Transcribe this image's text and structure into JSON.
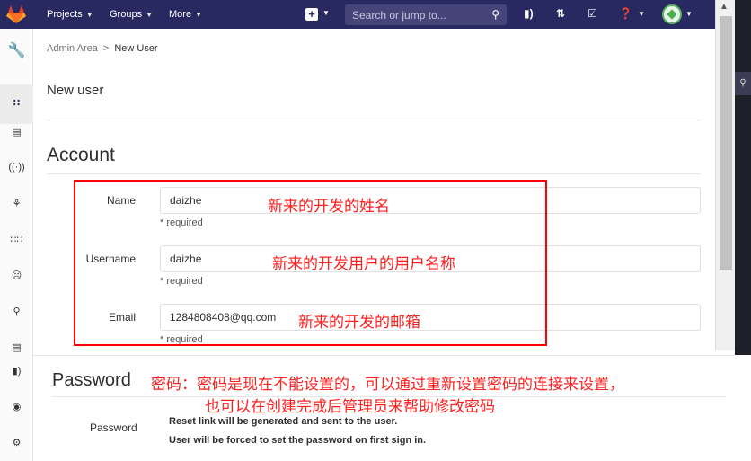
{
  "topbar": {
    "nav": [
      {
        "label": "Projects"
      },
      {
        "label": "Groups"
      },
      {
        "label": "More"
      }
    ],
    "search_placeholder": "Search or jump to...",
    "colors": {
      "bg": "#292961",
      "search_bg": "#45457a"
    }
  },
  "breadcrumb": {
    "parent": "Admin Area",
    "separator": ">",
    "current": "New User"
  },
  "page_title": "New user",
  "account": {
    "title": "Account",
    "fields": [
      {
        "label": "Name",
        "value": "daizhe",
        "required": "* required",
        "note": "新来的开发的姓名"
      },
      {
        "label": "Username",
        "value": "daizhe",
        "required": "* required",
        "note": "新来的开发用户的用户名称"
      },
      {
        "label": "Email",
        "value": "1284808408@qq.com",
        "required": "* required",
        "note": "新来的开发的邮箱"
      }
    ]
  },
  "password": {
    "title": "Password",
    "note_line1": "密码：密码是现在不能设置的，可以通过重新设置密码的连接来设置，",
    "note_line2": "也可以在创建完成后管理员来帮助修改密码",
    "label": "Password",
    "info_line1": "Reset link will be generated and sent to the user.",
    "info_line2": "User will be forced to set the password on first sign in."
  },
  "annotation_color": "#ff0000"
}
